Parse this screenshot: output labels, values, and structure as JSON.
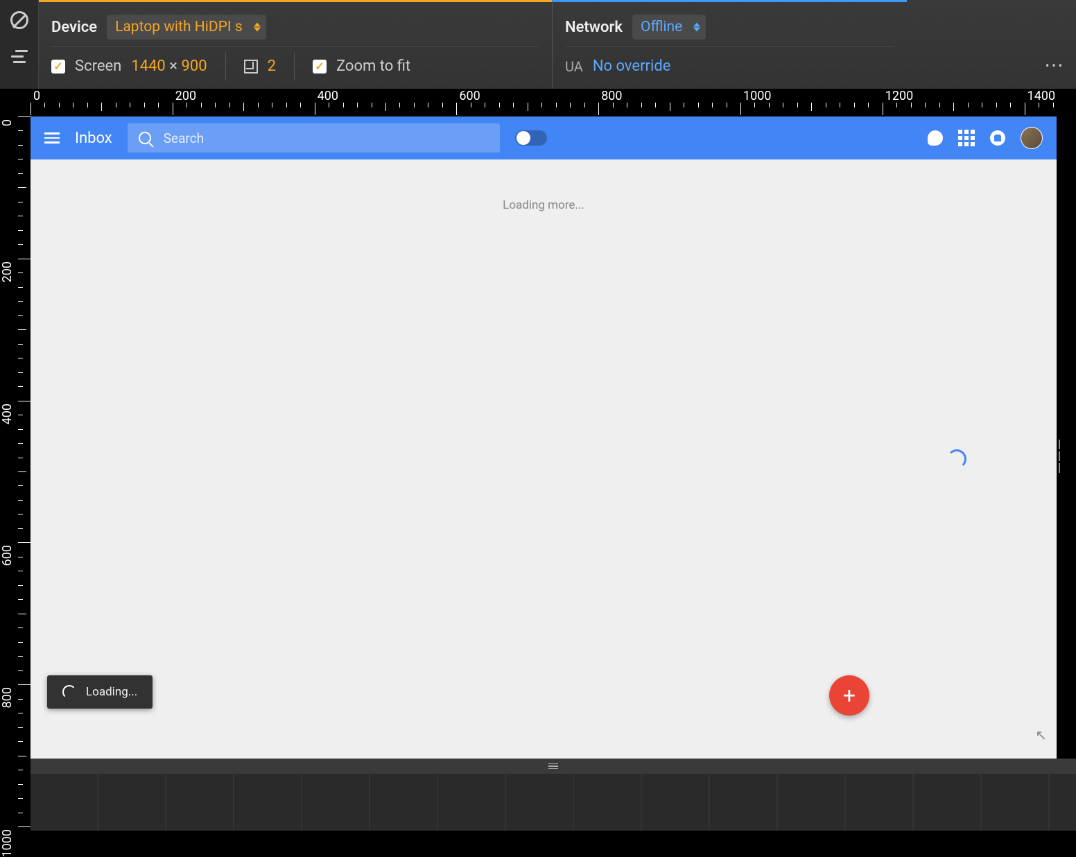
{
  "devtools": {
    "device_label": "Device",
    "device_value": "Laptop with HiDPI s",
    "network_label": "Network",
    "network_value": "Offline",
    "screen_label": "Screen",
    "width": "1440",
    "height": "900",
    "times": "×",
    "dpr": "2",
    "zoom_label": "Zoom to fit",
    "ua_label": "UA",
    "ua_value": "No override"
  },
  "ruler": {
    "h": [
      "0",
      "200",
      "400",
      "600",
      "800",
      "1000",
      "1200",
      "1400"
    ],
    "v": [
      "0",
      "200",
      "400",
      "600",
      "800",
      "1000"
    ]
  },
  "inbox": {
    "title": "Inbox",
    "search_placeholder": "Search",
    "loading_more": "Loading more...",
    "toast_text": "Loading...",
    "compose": "+"
  }
}
